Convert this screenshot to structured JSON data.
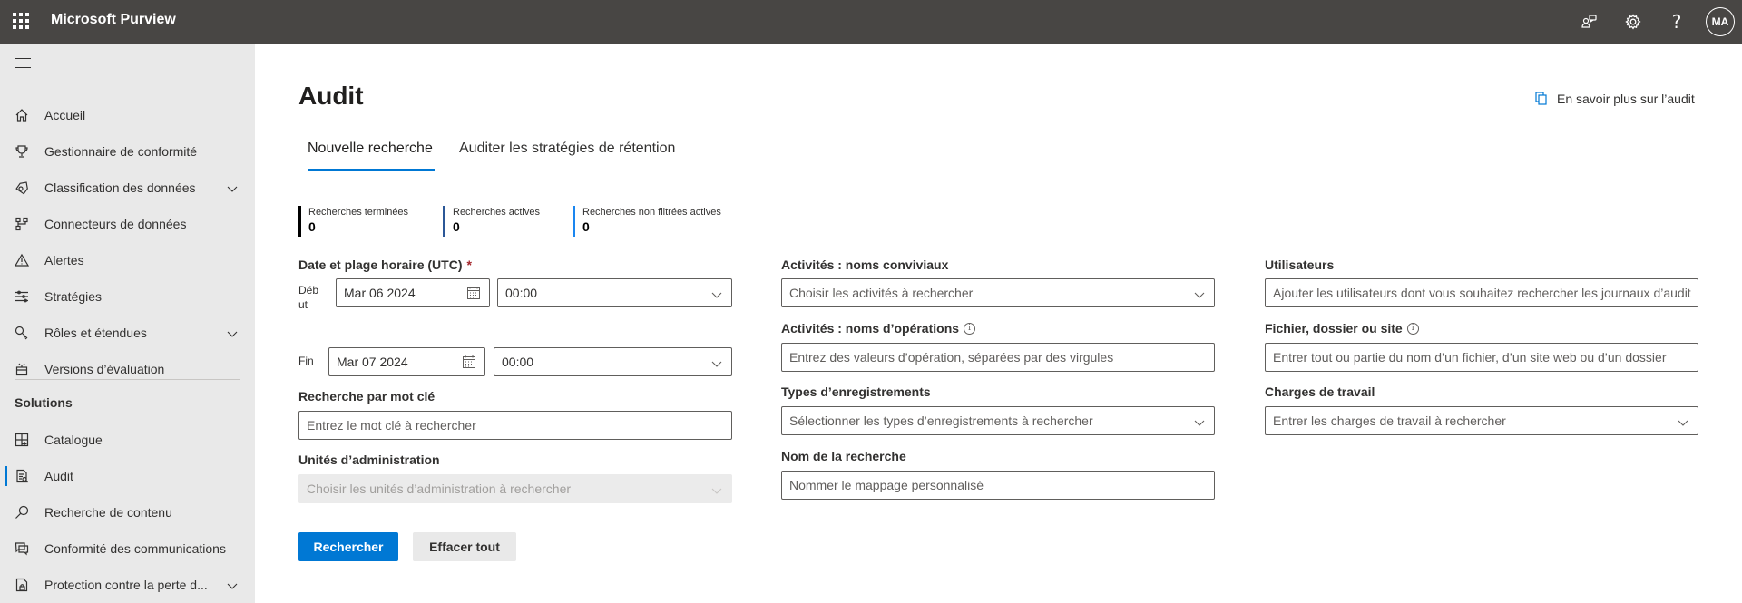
{
  "header": {
    "app_title": "Microsoft Purview",
    "icons": [
      "waffle-icon",
      "community-icon",
      "settings-icon",
      "help-icon"
    ],
    "help_glyph": "?",
    "avatar_initials": "MA"
  },
  "sidebar": {
    "items": [
      {
        "label": "Accueil",
        "icon": "home-icon",
        "expandable": false
      },
      {
        "label": "Gestionnaire de conformité",
        "icon": "trophy-icon",
        "expandable": false
      },
      {
        "label": "Classification des données",
        "icon": "tag-icon",
        "expandable": true
      },
      {
        "label": "Connecteurs de données",
        "icon": "connector-icon",
        "expandable": false
      },
      {
        "label": "Alertes",
        "icon": "warning-icon",
        "expandable": false
      },
      {
        "label": "Stratégies",
        "icon": "sliders-icon",
        "expandable": false
      },
      {
        "label": "Rôles et étendues",
        "icon": "key-icon",
        "expandable": true
      },
      {
        "label": "Versions d’évaluation",
        "icon": "trial-icon",
        "expandable": false
      }
    ],
    "section_title": "Solutions",
    "solutions": [
      {
        "label": "Catalogue",
        "icon": "catalog-icon",
        "expandable": false,
        "active": false
      },
      {
        "label": "Audit",
        "icon": "audit-icon",
        "expandable": false,
        "active": true
      },
      {
        "label": "Recherche de contenu",
        "icon": "search-icon",
        "expandable": false,
        "active": false
      },
      {
        "label": "Conformité des communications",
        "icon": "chat-icon",
        "expandable": false,
        "active": false
      },
      {
        "label": "Protection contre la perte d...",
        "icon": "lock-doc-icon",
        "expandable": true,
        "active": false
      }
    ]
  },
  "main": {
    "title": "Audit",
    "learn_more": "En savoir plus sur l’audit",
    "tabs": [
      {
        "label": "Nouvelle recherche",
        "active": true
      },
      {
        "label": "Auditer les stratégies de rétention",
        "active": false
      }
    ],
    "stats": [
      {
        "label": "Recherches terminées",
        "value": "0",
        "color": "#000000"
      },
      {
        "label": "Recherches actives",
        "value": "0",
        "color": "#2b5797"
      },
      {
        "label": "Recherches non filtrées actives",
        "value": "0",
        "color": "#1a86f0"
      }
    ],
    "form": {
      "date_range": {
        "label": "Date et plage horaire (UTC)",
        "required_mark": "*",
        "start_label": "Début",
        "start_label_line1": "Déb",
        "start_label_line2": "ut",
        "start_date": "Mar 06 2024",
        "start_time": "00:00",
        "end_label": "Fin",
        "end_date": "Mar 07 2024",
        "end_time": "00:00"
      },
      "keyword": {
        "label": "Recherche par mot clé",
        "placeholder": "Entrez le mot clé à rechercher"
      },
      "admin_units": {
        "label": "Unités d’administration",
        "placeholder": "Choisir les unités d’administration à rechercher",
        "disabled": true
      },
      "activities_friendly": {
        "label": "Activités : noms conviviaux",
        "placeholder": "Choisir les activités à rechercher"
      },
      "activities_operations": {
        "label": "Activités : noms d’opérations",
        "placeholder": "Entrez des valeurs d’opération, séparées par des virgules",
        "info": "i"
      },
      "record_types": {
        "label": "Types d’enregistrements",
        "placeholder": "Sélectionner les types d’enregistrements à rechercher"
      },
      "search_name": {
        "label": "Nom de la recherche",
        "placeholder": "Nommer le mappage personnalisé"
      },
      "users": {
        "label": "Utilisateurs",
        "placeholder": "Ajouter les utilisateurs dont vous souhaitez rechercher les journaux d’audit"
      },
      "file_folder_site": {
        "label": "Fichier, dossier ou site",
        "placeholder": "Entrer tout ou partie du nom d’un fichier, d’un site web ou d’un dossier",
        "info": "i"
      },
      "workloads": {
        "label": "Charges de travail",
        "placeholder": "Entrer les charges de travail à rechercher"
      }
    },
    "buttons": {
      "search": "Rechercher",
      "clear": "Effacer tout"
    },
    "colors": {
      "accent": "#0078d4",
      "topbar": "#484644",
      "sidebar": "#e9e9e9"
    }
  }
}
